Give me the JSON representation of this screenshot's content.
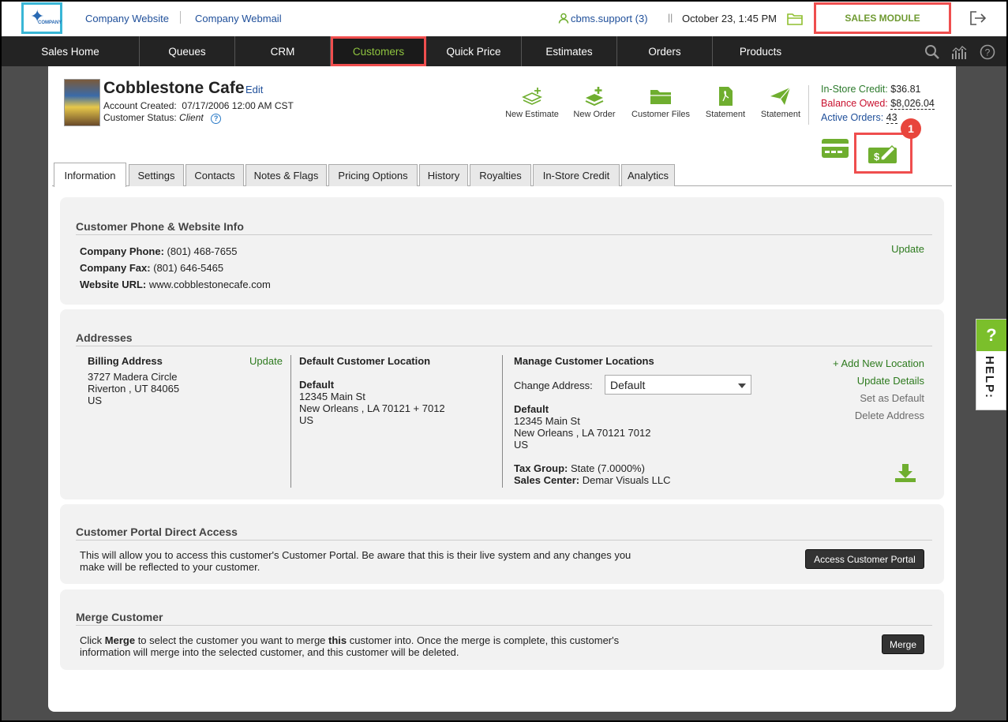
{
  "topbar": {
    "logo_text": "COMPANY",
    "company_website": "Company Website",
    "company_webmail": "Company Webmail",
    "user": "cbms.support (3)",
    "datetime": "October 23, 1:45 PM",
    "sales_module": "SALES MODULE"
  },
  "nav": {
    "items": [
      "Sales Home",
      "Queues",
      "CRM",
      "Customers",
      "Quick Price",
      "Estimates",
      "Orders",
      "Products"
    ],
    "active": "Customers"
  },
  "customer": {
    "name": "Cobblestone Cafe",
    "edit": "Edit",
    "created_label": "Account Created:",
    "created_value": "07/17/2006 12:00 AM CST",
    "status_label": "Customer Status:",
    "status_value": "Client"
  },
  "actions": [
    "New Estimate",
    "New Order",
    "Customer Files",
    "Statement",
    "Statement"
  ],
  "credits": {
    "instore_label": "In-Store Credit:",
    "instore_value": "$36.81",
    "balance_label": "Balance Owed:",
    "balance_value": "$8,026.04",
    "active_label": "Active Orders:",
    "active_value": "43"
  },
  "badge": "1",
  "tabs": [
    "Information",
    "Settings",
    "Contacts",
    "Notes & Flags",
    "Pricing Options",
    "History",
    "Royalties",
    "In-Store Credit",
    "Analytics"
  ],
  "phone_section": {
    "title": "Customer Phone & Website Info",
    "phone_label": "Company Phone:",
    "phone_value": "(801) 468-7655",
    "fax_label": "Company Fax:",
    "fax_value": "(801) 646-5465",
    "url_label": "Website URL:",
    "url_value": "www.cobblestonecafe.com",
    "update": "Update"
  },
  "addresses": {
    "title": "Addresses",
    "billing_title": "Billing Address",
    "billing_update": "Update",
    "billing_lines": [
      "3727 Madera Circle",
      "Riverton , UT 84065",
      "US"
    ],
    "default_title": "Default Customer Location",
    "default_name": "Default",
    "default_lines": [
      "12345 Main St",
      "New Orleans , LA 70121 + 7012",
      "US"
    ],
    "manage_title": "Manage Customer Locations",
    "change_label": "Change Address:",
    "change_value": "Default",
    "manage_name": "Default",
    "manage_lines": [
      "12345 Main St",
      "New Orleans , LA 70121 7012",
      "US"
    ],
    "tax_label": "Tax Group:",
    "tax_value": "State (7.0000%)",
    "center_label": "Sales Center:",
    "center_value": "Demar Visuals LLC",
    "add_location": "+ Add New Location",
    "update_details": "Update Details",
    "set_default": "Set as Default",
    "delete_address": "Delete Address"
  },
  "portal": {
    "title": "Customer Portal Direct Access",
    "text1": "This will allow you to access this customer's Customer Portal. Be aware that this is their live system and any changes you",
    "text2": "make will be reflected to your customer.",
    "button": "Access Customer Portal"
  },
  "merge": {
    "title": "Merge Customer",
    "click": "Click ",
    "merge_word": "Merge",
    "text_a": " to select the customer you want to merge ",
    "this_word": "this",
    "text_b": " customer into. Once the merge is complete, this customer's",
    "text2": "information will merge into the selected customer, and this customer will be deleted.",
    "button": "Merge"
  },
  "help": {
    "q": "?",
    "label": "HELP:"
  },
  "colors": {
    "accent_green": "#7bbf2b",
    "highlight_red": "#ef4e4e",
    "link_blue": "#1f4f9a",
    "balance_red": "#c8102e"
  }
}
